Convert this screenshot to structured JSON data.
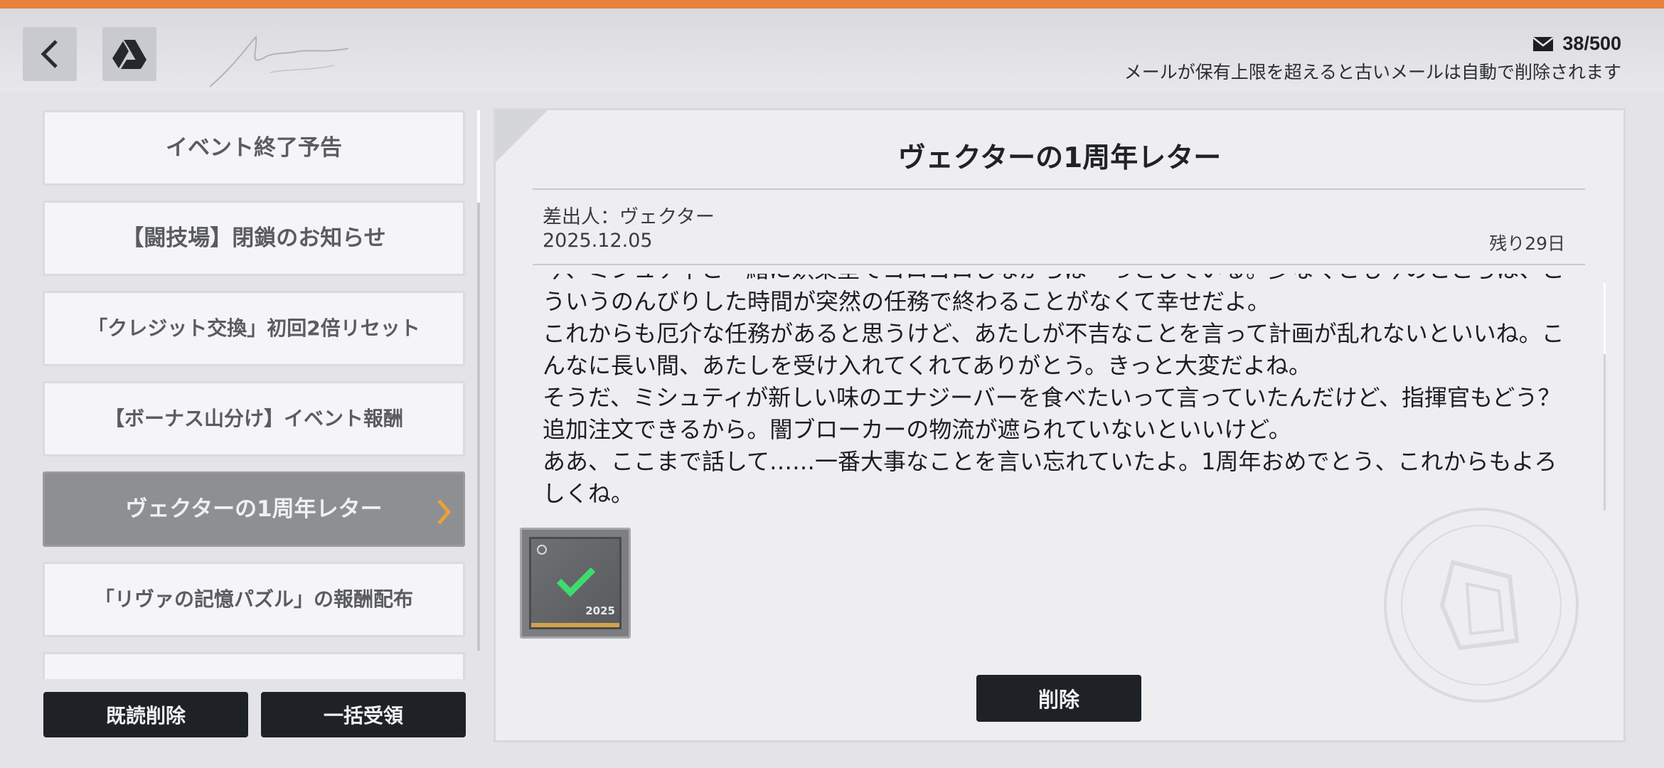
{
  "header": {
    "mail_count": "38/500",
    "notice": "メールが保有上限を超えると古いメールは自動で削除されます",
    "back_icon": "chevron-left-icon",
    "drive_icon": "drive-icon",
    "mail_icon": "envelope-icon"
  },
  "mail_list": [
    {
      "title": "イベント終了予告",
      "active": false
    },
    {
      "title": "【闘技場】閉鎖のお知らせ",
      "active": false
    },
    {
      "title": "「クレジット交換」初回2倍リセット",
      "active": false
    },
    {
      "title": "【ボーナス山分け】イベント報酬",
      "active": false
    },
    {
      "title": "ヴェクターの1周年レター",
      "active": true
    },
    {
      "title": "「リヴァの記憶パズル」の報酬配布",
      "active": false
    }
  ],
  "actions": {
    "read_delete": "既読削除",
    "claim_all": "一括受領",
    "delete": "削除"
  },
  "mail": {
    "title": "ヴェクターの1周年レター",
    "sender": "差出人：ヴェクター",
    "date": "2025.12.05",
    "remaining": "残り29日",
    "body": "今、ミシュティと一緒に娯楽室でゴロゴロしながらぼーっとしている。少なくとも今のところは、こういうのんびりした時間が突然の任務で終わることがなくて幸せだよ。\nこれからも厄介な任務があると思うけど、あたしが不吉なことを言って計画が乱れないといいね。こんなに長い間、あたしを受け入れてくれてありがとう。きっと大変だよね。\nそうだ、ミシュティが新しい味のエナジーバーを食べたいって言っていたんだけど、指揮官もどう？ 追加注文できるから。闇ブローカーの物流が遮られていないといいけど。\nああ、ここまで話して……一番大事なことを言い忘れていたよ。1周年おめでとう、これからもよろしくね。",
    "attachment": {
      "label": "2025",
      "claimed": true
    }
  },
  "colors": {
    "accent_stripe": "#e8813a",
    "button_dark": "#1e2227",
    "selected_item": "#8e8f93",
    "chevron": "#e8a23a",
    "check": "#3ddc6e"
  }
}
